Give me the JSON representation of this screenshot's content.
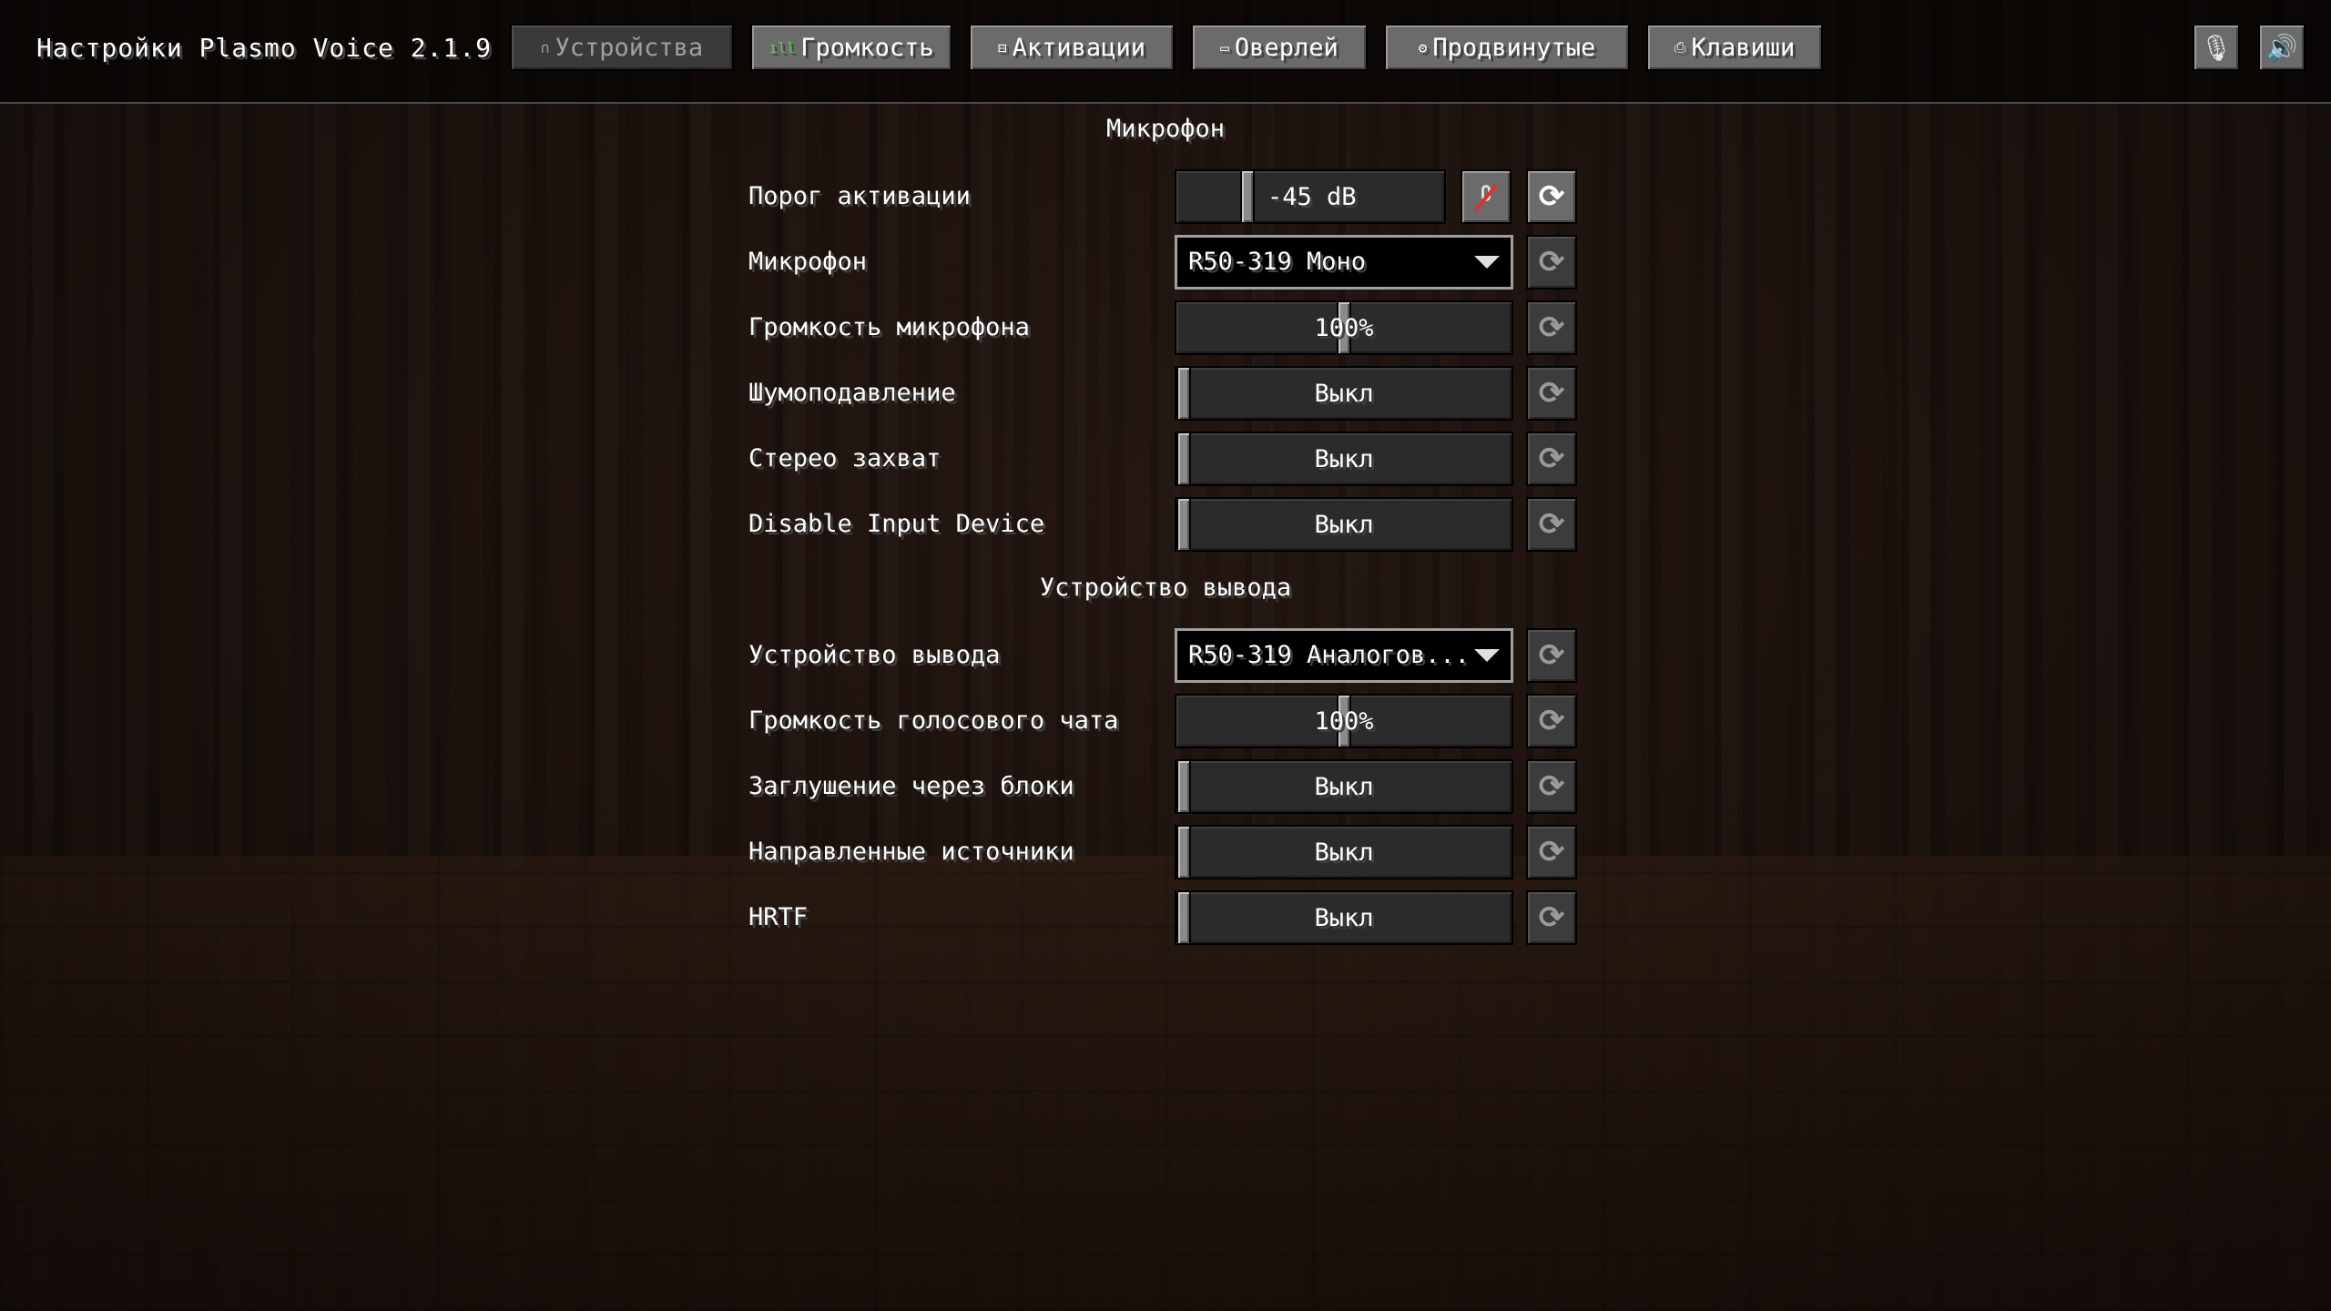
{
  "app": {
    "title": "Настройки Plasmo Voice 2.1.9"
  },
  "tabs": [
    {
      "label": "Устройства",
      "icon": "headphones-icon",
      "glyph": "∩"
    },
    {
      "label": "Громкость",
      "icon": "volume-bars-icon",
      "glyph": "ıll"
    },
    {
      "label": "Активации",
      "icon": "activation-icon",
      "glyph": "⊟"
    },
    {
      "label": "Оверлей",
      "icon": "overlay-icon",
      "glyph": "▭"
    },
    {
      "label": "Продвинутые",
      "icon": "gear-icon",
      "glyph": "⚙"
    },
    {
      "label": "Клавиши",
      "icon": "lock-icon",
      "glyph": "⎙"
    }
  ],
  "header_buttons": {
    "mic_glyph": "🎙",
    "speaker_glyph": "🔊"
  },
  "sections": {
    "microphone": "Микрофон",
    "output": "Устройство вывода"
  },
  "settings": {
    "activation_threshold": {
      "label": "Порог активации",
      "value": "-45 dB"
    },
    "microphone": {
      "label": "Микрофон",
      "value": "R50-319 Моно"
    },
    "mic_volume": {
      "label": "Громкость микрофона",
      "value": "100%"
    },
    "noise_suppression": {
      "label": "Шумоподавление",
      "value": "Выкл"
    },
    "stereo_capture": {
      "label": "Стерео захват",
      "value": "Выкл"
    },
    "disable_input": {
      "label": "Disable Input Device",
      "value": "Выкл"
    },
    "output_device": {
      "label": "Устройство вывода",
      "value": "R50-319 Аналогов..."
    },
    "voice_volume": {
      "label": "Громкость голосового чата",
      "value": "100%"
    },
    "block_occlusion": {
      "label": "Заглушение через блоки",
      "value": "Выкл"
    },
    "directional_sources": {
      "label": "Направленные источники",
      "value": "Выкл"
    },
    "hrtf": {
      "label": "HRTF",
      "value": "Выкл"
    }
  },
  "reset_glyph": "⟳",
  "colors": {
    "button_face": "#6b6b6b",
    "control_bg": "#2b2b2b",
    "text": "#ffffff",
    "mute_slash": "#e03030"
  }
}
